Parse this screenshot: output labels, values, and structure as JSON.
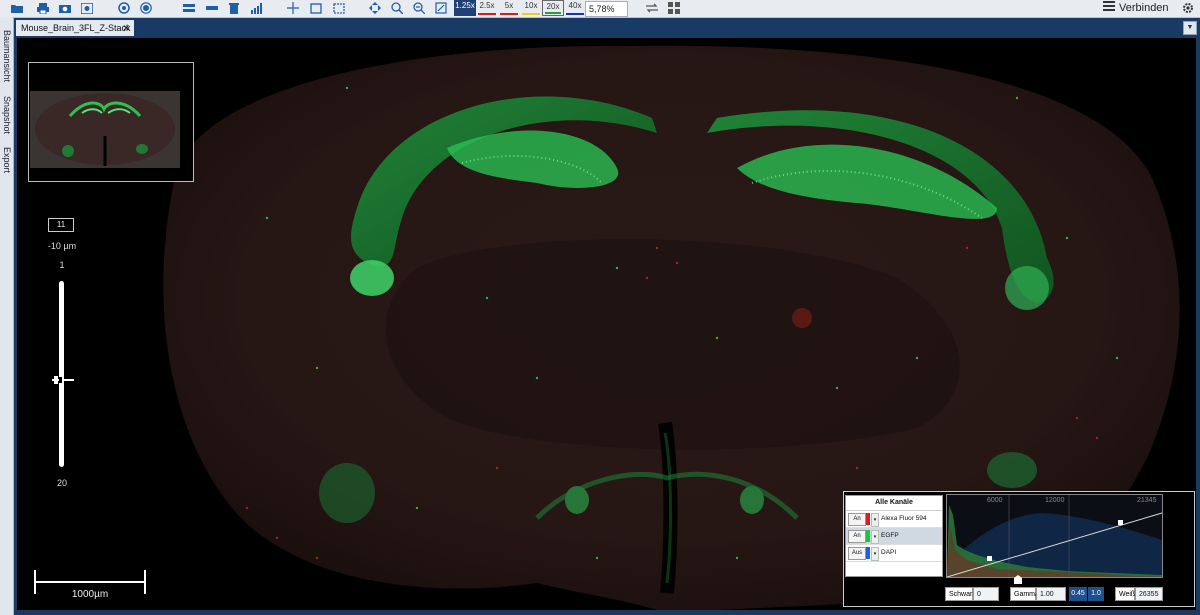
{
  "toolbar": {
    "icons": [
      "folder-open-icon",
      "print-icon",
      "camera-icon",
      "snapshot-icon",
      "view-icon",
      "target-icon",
      "layers-icon",
      "ruler-icon",
      "trash-icon",
      "histogram-icon",
      "crosshair-icon",
      "rectangle-select-icon",
      "annotation-icon",
      "pan-icon",
      "zoom-in-icon",
      "zoom-out-icon",
      "fit-icon"
    ],
    "zoom_levels": [
      {
        "label": "1.25x",
        "color": "#1f3f75",
        "active": true
      },
      {
        "label": "2.5x",
        "color": "#d02020"
      },
      {
        "label": "5x",
        "color": "#d02020"
      },
      {
        "label": "10x",
        "color": "#e6d010"
      },
      {
        "label": "20x",
        "color": "#20a040"
      },
      {
        "label": "40x",
        "color": "#2030c0"
      }
    ],
    "zoom_value": "5,78%",
    "connect_label": "Verbinden"
  },
  "side_tabs": [
    "Baumansicht",
    "Snapshot",
    "Export"
  ],
  "document_tab": {
    "title": "Mouse_Brain_3FL_Z-Stack",
    "close": "✕"
  },
  "viewer": {
    "z_index": "11",
    "z_step": "-10 µm",
    "z_min": "1",
    "z_max": "20",
    "z_position": 0.53,
    "scale_label": "1000µm"
  },
  "channels": {
    "header": "Alle Kanäle",
    "items": [
      {
        "state": "An",
        "name": "Alexa Fluor 594",
        "color": "#d02020",
        "selected": false
      },
      {
        "state": "An",
        "name": "EGFP",
        "color": "#20c040",
        "selected": true
      },
      {
        "state": "Aus",
        "name": "DAPI",
        "color": "#2060e0",
        "selected": false
      }
    ]
  },
  "histogram": {
    "ticks": [
      "6000",
      "12000",
      "21345"
    ]
  },
  "display_controls": {
    "black_label": "Schwarz",
    "black_value": "0",
    "gamma_label": "Gamma",
    "gamma_value": "1.00",
    "gamma_presets": [
      "0.45",
      "1.0"
    ],
    "white_label": "Weiß",
    "white_value": "26355"
  }
}
